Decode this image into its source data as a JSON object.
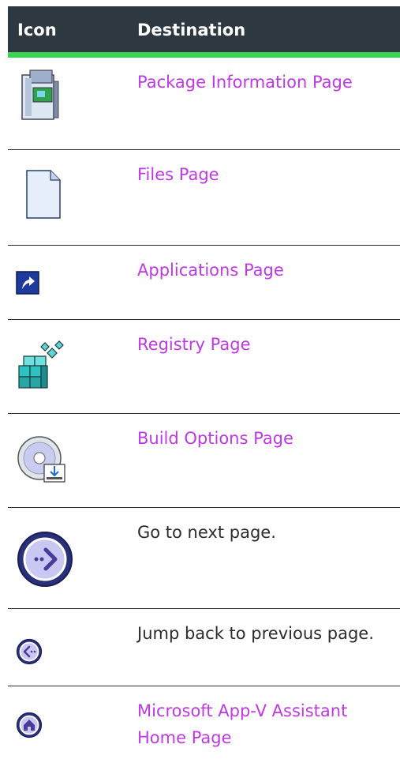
{
  "header": {
    "col_icon": "Icon",
    "col_destination": "Destination"
  },
  "rows": [
    {
      "icon": "package-info-icon",
      "text": "Package Information Page",
      "link": true
    },
    {
      "icon": "file-page-icon",
      "text": "Files Page",
      "link": true
    },
    {
      "icon": "shortcut-arrow-icon",
      "text": "Applications Page",
      "link": true
    },
    {
      "icon": "registry-cubes-icon",
      "text": "Registry Page",
      "link": true
    },
    {
      "icon": "build-disc-icon",
      "text": "Build Options Page",
      "link": true
    },
    {
      "icon": "next-arrow-circle-icon",
      "text": "Go to next page.",
      "link": false
    },
    {
      "icon": "back-arrow-circle-icon",
      "text": "Jump back to previous page.",
      "link": false
    },
    {
      "icon": "home-circle-icon",
      "text": "Microsoft App-V Assistant Home Page",
      "link": true
    }
  ]
}
